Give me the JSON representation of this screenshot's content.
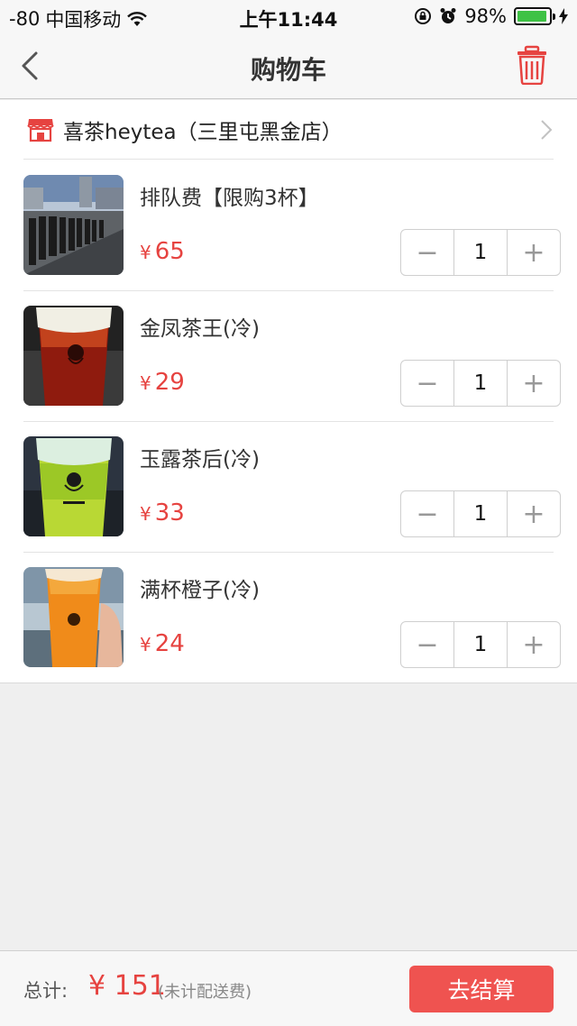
{
  "status_bar": {
    "signal": "-80",
    "carrier": "中国移动",
    "time": "上午11:44",
    "battery": "98%"
  },
  "nav": {
    "title": "购物车"
  },
  "store": {
    "name": "喜茶heytea（三里屯黑金店）"
  },
  "currency_symbol": "¥",
  "items": [
    {
      "name": "排队费【限购3杯】",
      "price": "65",
      "qty": "1"
    },
    {
      "name": "金凤茶王(冷)",
      "price": "29",
      "qty": "1"
    },
    {
      "name": "玉露茶后(冷)",
      "price": "33",
      "qty": "1"
    },
    {
      "name": "满杯橙子(冷)",
      "price": "24",
      "qty": "1"
    }
  ],
  "stepper": {
    "minus": "−",
    "plus": "+"
  },
  "footer": {
    "total_label": "总计:",
    "total_amount": "¥ 151",
    "total_note": "(未计配送费)",
    "checkout_label": "去结算"
  },
  "colors": {
    "accent": "#e64340",
    "checkout_bg": "#ef5350",
    "battery": "#3ec245"
  }
}
